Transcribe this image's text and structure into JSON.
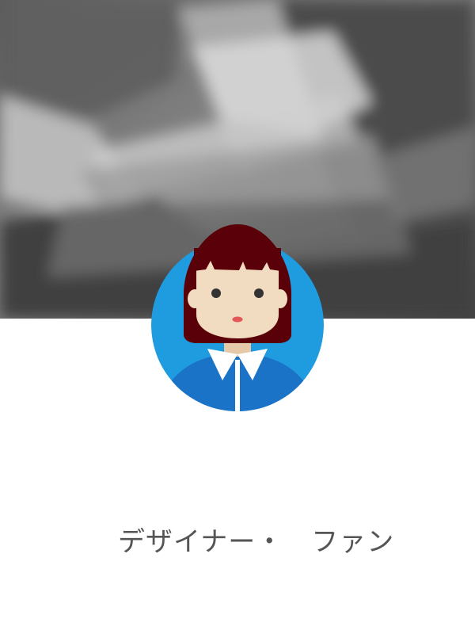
{
  "profile": {
    "title": "デザイナー・　ファン",
    "cover_image": "blurred-grayscale-photo",
    "avatar_icon": "woman-avatar-icon",
    "colors": {
      "avatar_background": "#1f9be0",
      "hair": "#5a0008",
      "skin": "#f1dcc2",
      "shirt": "#1b73c8",
      "collar": "#ffffff",
      "name_text": "#555555"
    }
  }
}
